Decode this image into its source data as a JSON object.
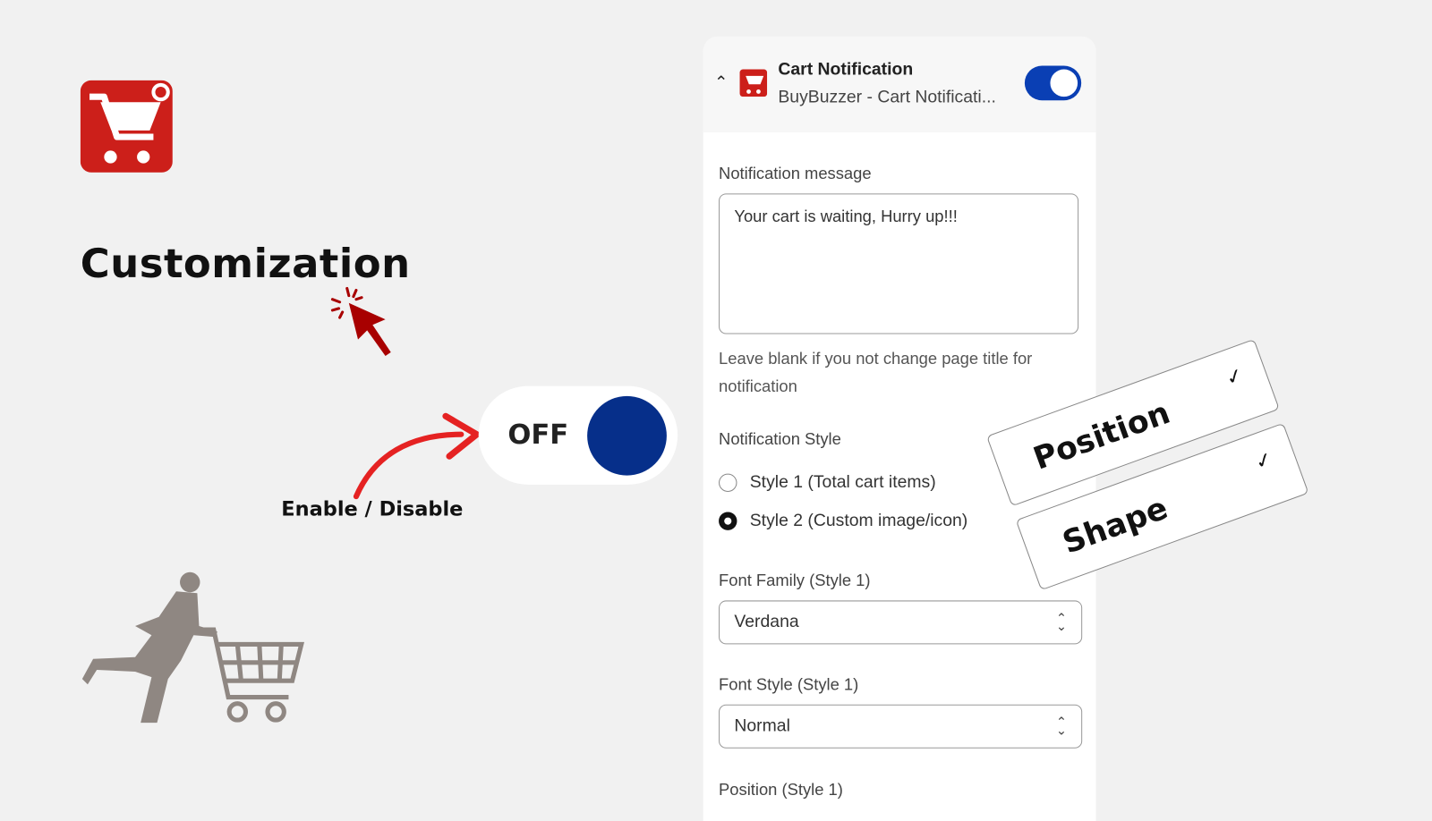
{
  "hero": {
    "title": "Customization",
    "enable_label": "Enable / Disable",
    "toggle_label": "OFF",
    "accent_color": "#cc1f1a",
    "knob_color": "#062f8a"
  },
  "panel": {
    "title": "Cart Notification",
    "subtitle": "BuyBuzzer - Cart Notificati...",
    "enabled": true,
    "toggle_color": "#0a3fb4",
    "message_label": "Notification message",
    "message_value": "Your cart is waiting, Hurry up!!!",
    "help_text": "Leave blank if you not change page title for notification",
    "style_label": "Notification Style",
    "styles": [
      {
        "label": "Style 1 (Total cart items)",
        "selected": false
      },
      {
        "label": "Style 2 (Custom image/icon)",
        "selected": true
      }
    ],
    "font_family_label": "Font Family (Style 1)",
    "font_family_value": "Verdana",
    "font_style_label": "Font Style (Style 1)",
    "font_style_value": "Normal",
    "position_label": "Position (Style 1)"
  },
  "cards": {
    "position": "Position",
    "shape": "Shape"
  }
}
